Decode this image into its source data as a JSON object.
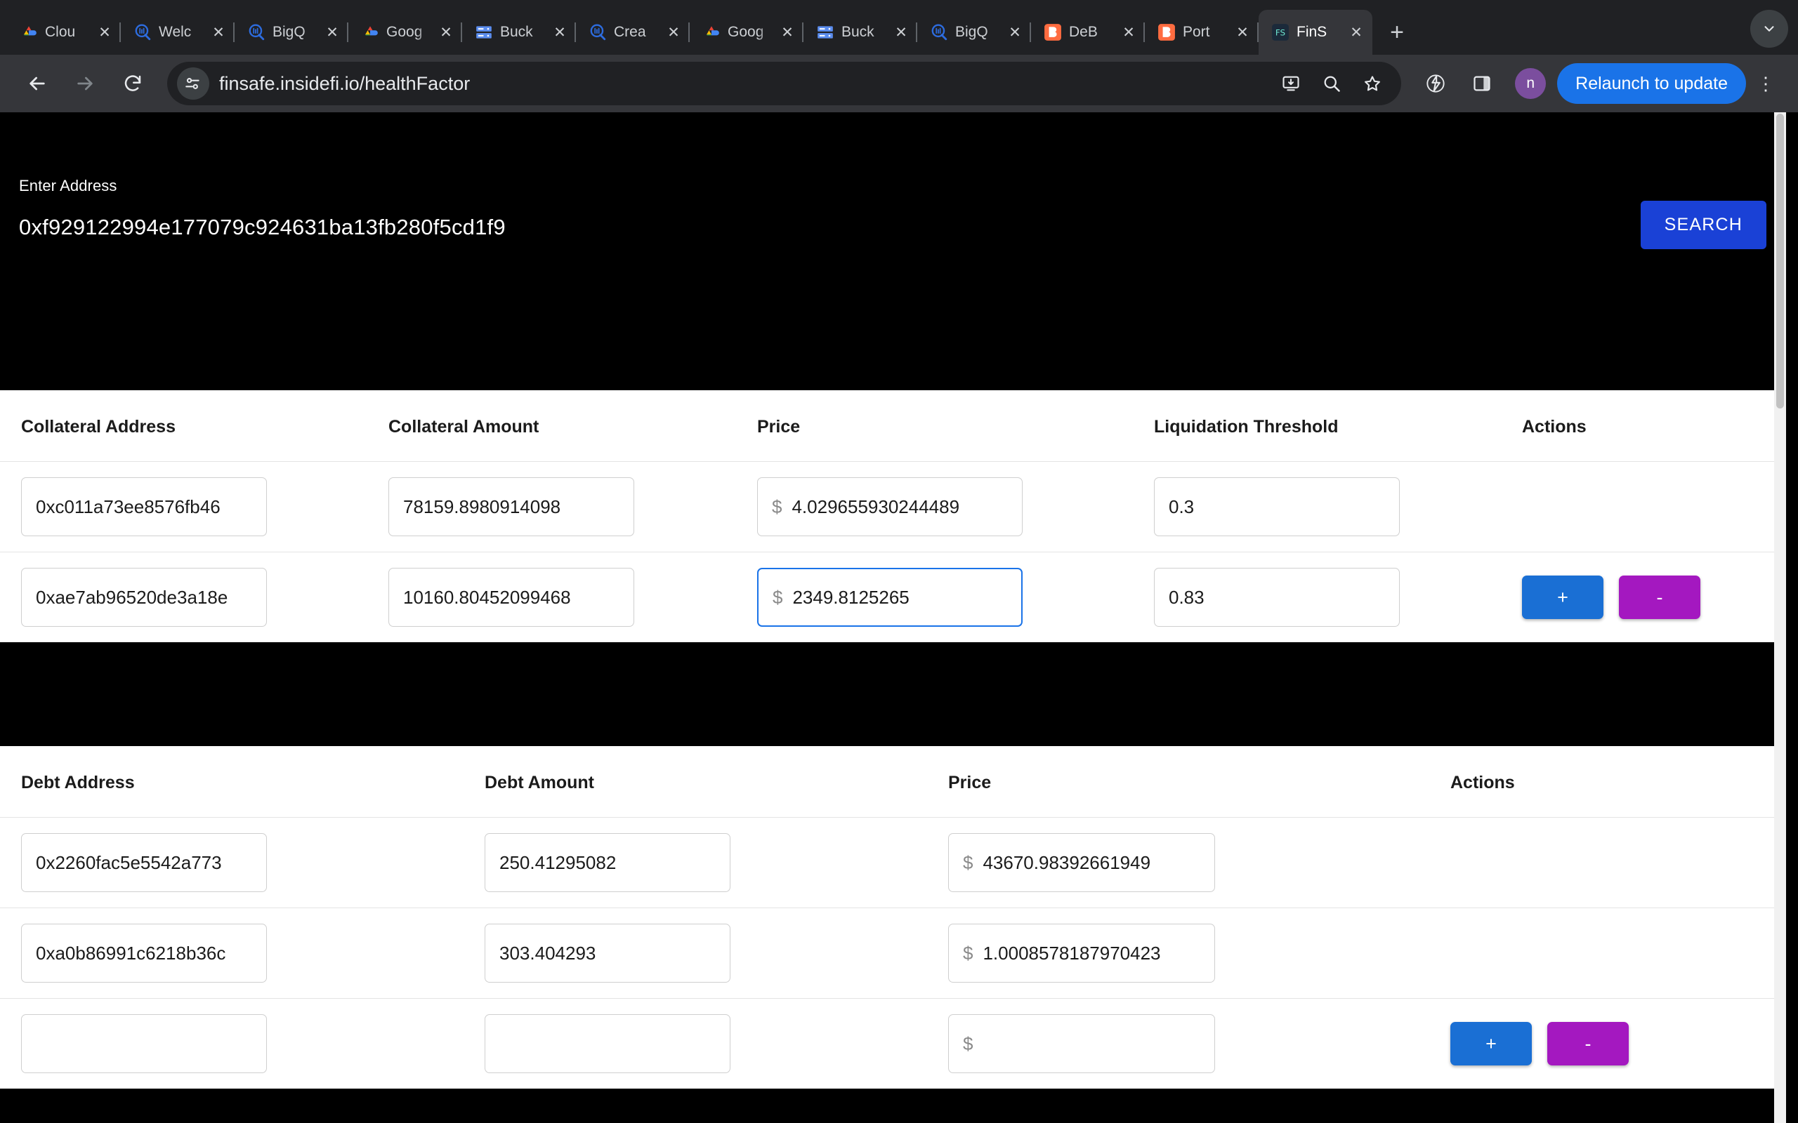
{
  "browser": {
    "tabs": [
      {
        "title": "Clou",
        "favicon": "google-cloud-icon",
        "active": false
      },
      {
        "title": "Welc",
        "favicon": "quicksight-icon",
        "active": false
      },
      {
        "title": "BigQ",
        "favicon": "quicksight-icon",
        "active": false
      },
      {
        "title": "Goog",
        "favicon": "google-cloud-icon",
        "active": false
      },
      {
        "title": "Buck",
        "favicon": "buckets-icon",
        "active": false
      },
      {
        "title": "Crea",
        "favicon": "quicksight-icon",
        "active": false
      },
      {
        "title": "Goog",
        "favicon": "google-cloud-icon",
        "active": false
      },
      {
        "title": "Buck",
        "favicon": "buckets-icon",
        "active": false
      },
      {
        "title": "BigQ",
        "favicon": "quicksight-icon",
        "active": false
      },
      {
        "title": "DeB",
        "favicon": "debank-icon",
        "active": false
      },
      {
        "title": "Port",
        "favicon": "portal-icon",
        "active": false
      },
      {
        "title": "FinS",
        "favicon": "finsafe-icon",
        "active": true
      }
    ],
    "new_tab_label": "+",
    "tab_list_chevron": "chevron-down-icon",
    "toolbar": {
      "back": "back-arrow-icon",
      "forward": "forward-arrow-icon",
      "reload": "reload-icon",
      "site_info": "page-settings-icon",
      "url": "finsafe.insidefi.io/healthFactor",
      "install_icon": "install-app-icon",
      "zoom_icon": "zoom-search-icon",
      "bookmark_icon": "star-icon",
      "extensions_icon": "extensions-icon",
      "sidepanel_icon": "side-panel-icon",
      "profile_initial": "n",
      "relaunch_label": "Relaunch to update",
      "menu_icon": "kebab-menu-icon"
    }
  },
  "page": {
    "search": {
      "label": "Enter Address",
      "value": "0xf929122994e177079c924631ba13fb280f5cd1f9",
      "placeholder": "Enter Address",
      "button_label": "SEARCH"
    },
    "collateral_table": {
      "headers": [
        "Collateral Address",
        "Collateral Amount",
        "Price",
        "Liquidation Threshold",
        "Actions"
      ],
      "rows": [
        {
          "address": "0xc011a73ee8576fb46",
          "amount": "78159.8980914098",
          "price_symbol": "$",
          "price": "4.029655930244489",
          "threshold": "0.3",
          "has_actions": false,
          "price_focused": false
        },
        {
          "address": "0xae7ab96520de3a18e",
          "amount": "10160.80452099468",
          "price_symbol": "$",
          "price": "2349.8125265",
          "threshold": "0.83",
          "has_actions": true,
          "price_focused": true
        }
      ],
      "add_label": "+",
      "remove_label": "-"
    },
    "debt_table": {
      "headers": [
        "Debt Address",
        "Debt Amount",
        "Price",
        "Actions"
      ],
      "rows": [
        {
          "address": "0x2260fac5e5542a773",
          "amount": "250.41295082",
          "price_symbol": "$",
          "price": "43670.98392661949",
          "has_actions": false
        },
        {
          "address": "0xa0b86991c6218b36c",
          "amount": "303.404293",
          "price_symbol": "$",
          "price": "1.0008578187970423",
          "has_actions": false
        },
        {
          "address": "",
          "amount": "",
          "price_symbol": "$",
          "price": "",
          "has_actions": true
        }
      ],
      "add_label": "+",
      "remove_label": "-"
    }
  },
  "colors": {
    "search_button": "#1a41d6",
    "add_button": "#1a6fd4",
    "remove_button": "#a418c0",
    "focus_border": "#1a73e8",
    "page_background": "#000000",
    "table_background": "#ffffff"
  }
}
